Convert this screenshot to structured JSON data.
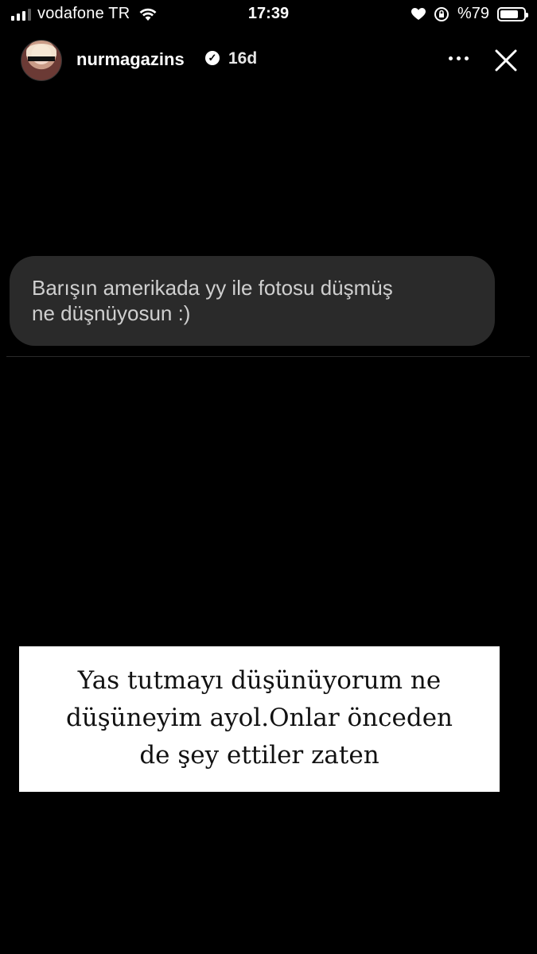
{
  "status_bar": {
    "carrier": "vodafone TR",
    "time": "17:39",
    "battery_text": "%79",
    "battery_level": 0.79,
    "icons": [
      "signal-icon",
      "wifi-icon",
      "heart-icon",
      "screen-lock-icon",
      "battery-icon"
    ]
  },
  "story_header": {
    "username": "nurmagazins",
    "verified": true,
    "time_ago": "16d",
    "actions": [
      "more-options-icon",
      "close-icon"
    ]
  },
  "question_sticker": {
    "line1": "Barışın amerikada yy ile fotosu düşmüş",
    "line2": "ne düşnüyosun :)"
  },
  "answer_text": {
    "line1": "Yas tutmayı düşünüyorum ne",
    "line2": "düşüneyim ayol.Onlar önceden",
    "line3": "de şey ettiler zaten"
  }
}
